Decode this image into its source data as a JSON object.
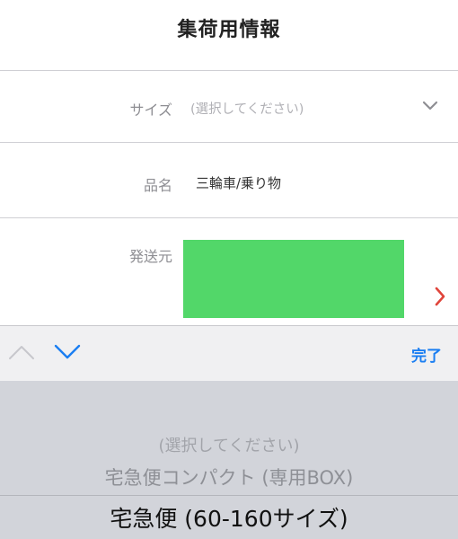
{
  "header": {
    "title": "集荷用情報"
  },
  "form": {
    "size": {
      "label": "サイズ",
      "placeholder": "(選択してください)"
    },
    "item_name": {
      "label": "品名",
      "value": "三輪車/乗り物"
    },
    "sender": {
      "label": "発送元"
    }
  },
  "toolbar": {
    "done_label": "完了"
  },
  "picker": {
    "options": [
      "(選択してください)",
      "宅急便コンパクト (専用BOX)",
      "宅急便 (60-160サイズ)"
    ],
    "selected_index": 2
  },
  "colors": {
    "accent": "#1a7ef2",
    "redaction": "#52d769",
    "chevron_right": "#e0453b"
  }
}
